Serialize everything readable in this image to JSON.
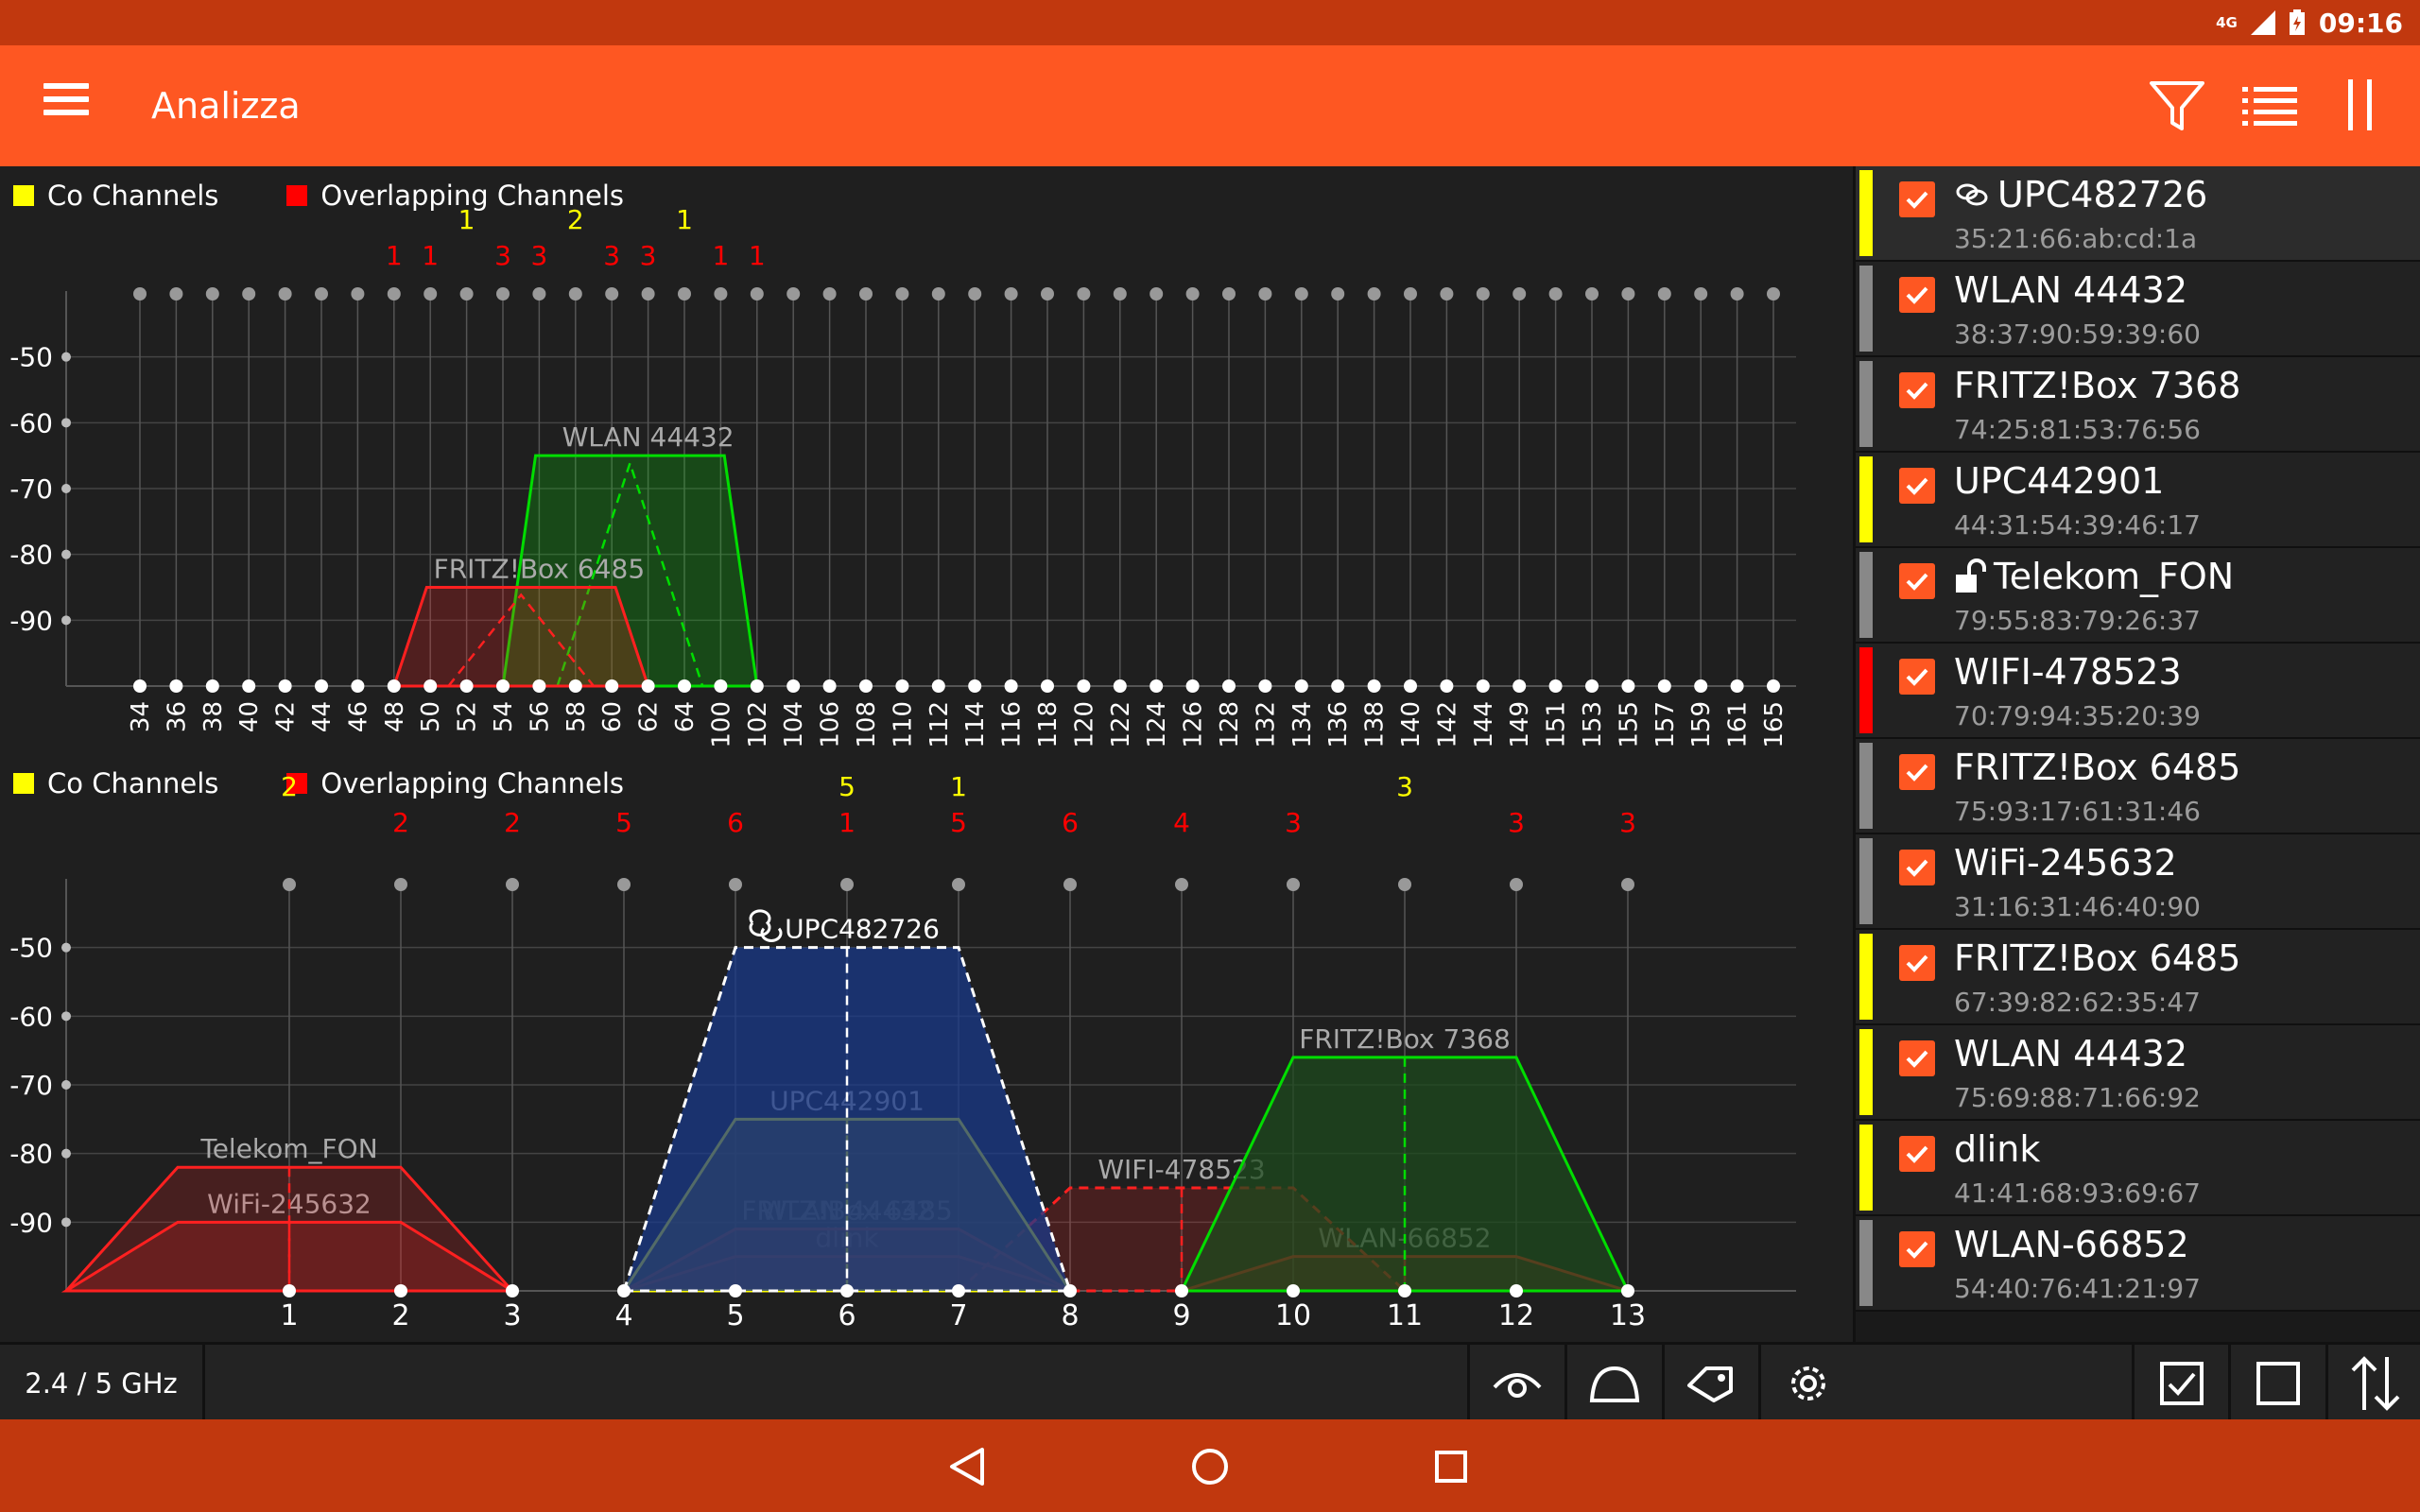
{
  "status": {
    "network": "4G",
    "time": "09:16"
  },
  "appbar": {
    "title": "Analizza"
  },
  "icons": {
    "menu": "menu-icon",
    "filter": "filter-icon",
    "list": "list-icon",
    "pause": "pause-icon"
  },
  "legend": {
    "co": "Co Channels",
    "overlap": "Overlapping Channels"
  },
  "colors": {
    "co": "#ffff00",
    "overlap": "#ff0000",
    "accent": "#fe5722"
  },
  "chart_data": [
    {
      "type": "area",
      "band": "5 GHz",
      "ylim": [
        -100,
        -40
      ],
      "yticks": [
        -50,
        -60,
        -70,
        -80,
        -90
      ],
      "channels": [
        "34",
        "36",
        "38",
        "40",
        "42",
        "44",
        "46",
        "48",
        "50",
        "52",
        "54",
        "56",
        "58",
        "60",
        "62",
        "64",
        "100",
        "102",
        "104",
        "106",
        "108",
        "110",
        "112",
        "114",
        "116",
        "118",
        "120",
        "122",
        "124",
        "126",
        "128",
        "132",
        "134",
        "136",
        "138",
        "140",
        "142",
        "144",
        "149",
        "151",
        "153",
        "155",
        "157",
        "159",
        "161",
        "165"
      ],
      "counts": [
        {
          "index": 7,
          "value": "1",
          "kind": "overlap"
        },
        {
          "index": 8,
          "value": "1",
          "kind": "overlap"
        },
        {
          "index": 9,
          "value": "1",
          "kind": "co"
        },
        {
          "index": 10,
          "value": "3",
          "kind": "overlap"
        },
        {
          "index": 11,
          "value": "3",
          "kind": "overlap"
        },
        {
          "index": 12,
          "value": "2",
          "kind": "co"
        },
        {
          "index": 13,
          "value": "3",
          "kind": "overlap"
        },
        {
          "index": 14,
          "value": "3",
          "kind": "overlap"
        },
        {
          "index": 15,
          "value": "1",
          "kind": "co"
        },
        {
          "index": 16,
          "value": "1",
          "kind": "overlap"
        },
        {
          "index": 17,
          "value": "1",
          "kind": "overlap"
        }
      ],
      "series": [
        {
          "name": "WLAN 44432",
          "color": "#00dd00",
          "dash": false,
          "from": 10,
          "to": 17,
          "center": 13.5,
          "level": -65
        },
        {
          "name": "FRITZ!Box 6485",
          "color": "#ff2020",
          "dash": false,
          "from": 7,
          "to": 14,
          "center": 10.5,
          "level": -85
        }
      ]
    },
    {
      "type": "area",
      "band": "2.4 GHz",
      "ylim": [
        -100,
        -40
      ],
      "yticks": [
        -50,
        -60,
        -70,
        -80,
        -90
      ],
      "channels": [
        "1",
        "2",
        "3",
        "4",
        "5",
        "6",
        "7",
        "8",
        "9",
        "10",
        "11",
        "12",
        "13"
      ],
      "counts": [
        {
          "channel": 1,
          "value": "2",
          "kind": "co",
          "row": 0
        },
        {
          "channel": 2,
          "value": "2",
          "kind": "overlap",
          "row": 1
        },
        {
          "channel": 3,
          "value": "2",
          "kind": "overlap",
          "row": 1
        },
        {
          "channel": 4,
          "value": "5",
          "kind": "overlap",
          "row": 1
        },
        {
          "channel": 5,
          "value": "6",
          "kind": "overlap",
          "row": 1
        },
        {
          "channel": 6,
          "value": "5",
          "kind": "co",
          "row": 0
        },
        {
          "channel": 6,
          "value": "1",
          "kind": "overlap",
          "row": 1
        },
        {
          "channel": 7,
          "value": "1",
          "kind": "co",
          "row": 0
        },
        {
          "channel": 7,
          "value": "5",
          "kind": "overlap",
          "row": 1
        },
        {
          "channel": 8,
          "value": "6",
          "kind": "overlap",
          "row": 1
        },
        {
          "channel": 9,
          "value": "4",
          "kind": "overlap",
          "row": 1
        },
        {
          "channel": 10,
          "value": "3",
          "kind": "overlap",
          "row": 1
        },
        {
          "channel": 11,
          "value": "3",
          "kind": "co",
          "row": 0
        },
        {
          "channel": 12,
          "value": "3",
          "kind": "overlap",
          "row": 1
        },
        {
          "channel": 13,
          "value": "3",
          "kind": "overlap",
          "row": 1
        }
      ],
      "series": [
        {
          "name": "UPC482726",
          "color": "#ffffff",
          "fill": "#1a3a8a",
          "dash": true,
          "center": 6,
          "level": -50,
          "linked": true
        },
        {
          "name": "UPC442901",
          "color": "#ffff00",
          "fill": "#5a5a1a",
          "dash": false,
          "center": 6,
          "level": -75
        },
        {
          "name": "FRITZ!Box 7368",
          "color": "#00dd00",
          "fill": "#1d4a1d",
          "dash": false,
          "center": 11,
          "level": -66
        },
        {
          "name": "Telekom_FON",
          "color": "#ff2020",
          "dash": false,
          "center": 1,
          "level": -82
        },
        {
          "name": "WiFi-245632",
          "color": "#ff2020",
          "dash": false,
          "center": 1,
          "level": -90
        },
        {
          "name": "WIFI-478523",
          "color": "#ff2020",
          "dash": true,
          "center": 9,
          "level": -85
        },
        {
          "name": "FRITZ!Box 6485",
          "color": "#ff2020",
          "dash": false,
          "center": 6,
          "level": -91
        },
        {
          "name": "WLAN 44432",
          "color": "#ff2020",
          "dash": false,
          "center": 6,
          "level": -91
        },
        {
          "name": "dlink",
          "color": "#ff2020",
          "dash": false,
          "center": 6,
          "level": -95
        },
        {
          "name": "WLAN-66852",
          "color": "#ff2020",
          "dash": false,
          "center": 11,
          "level": -95
        }
      ]
    }
  ],
  "sidebar": {
    "items": [
      {
        "ssid": "UPC482726",
        "mac": "35:21:66:ab:cd:1a",
        "strip": "#ffff00",
        "icon": "link-icon",
        "selected": true
      },
      {
        "ssid": "WLAN 44432",
        "mac": "38:37:90:59:39:60",
        "strip": "#888888",
        "icon": "",
        "selected": false
      },
      {
        "ssid": "FRITZ!Box 7368",
        "mac": "74:25:81:53:76:56",
        "strip": "#888888",
        "icon": "",
        "selected": false
      },
      {
        "ssid": "UPC442901",
        "mac": "44:31:54:39:46:17",
        "strip": "#ffff00",
        "icon": "",
        "selected": false
      },
      {
        "ssid": "Telekom_FON",
        "mac": "79:55:83:79:26:37",
        "strip": "#888888",
        "icon": "unlock-icon",
        "selected": false
      },
      {
        "ssid": "WIFI-478523",
        "mac": "70:79:94:35:20:39",
        "strip": "#ff0000",
        "icon": "",
        "selected": false
      },
      {
        "ssid": "FRITZ!Box 6485",
        "mac": "75:93:17:61:31:46",
        "strip": "#888888",
        "icon": "",
        "selected": false
      },
      {
        "ssid": "WiFi-245632",
        "mac": "31:16:31:46:40:90",
        "strip": "#888888",
        "icon": "",
        "selected": false
      },
      {
        "ssid": "FRITZ!Box 6485",
        "mac": "67:39:82:62:35:47",
        "strip": "#ffff00",
        "icon": "",
        "selected": false
      },
      {
        "ssid": "WLAN 44432",
        "mac": "75:69:88:71:66:92",
        "strip": "#ffff00",
        "icon": "",
        "selected": false
      },
      {
        "ssid": "dlink",
        "mac": "41:41:68:93:69:67",
        "strip": "#ffff00",
        "icon": "",
        "selected": false
      },
      {
        "ssid": "WLAN-66852",
        "mac": "54:40:76:41:21:97",
        "strip": "#888888",
        "icon": "",
        "selected": false
      }
    ]
  },
  "bottombar": {
    "band_label": "2.4 / 5 GHz"
  }
}
